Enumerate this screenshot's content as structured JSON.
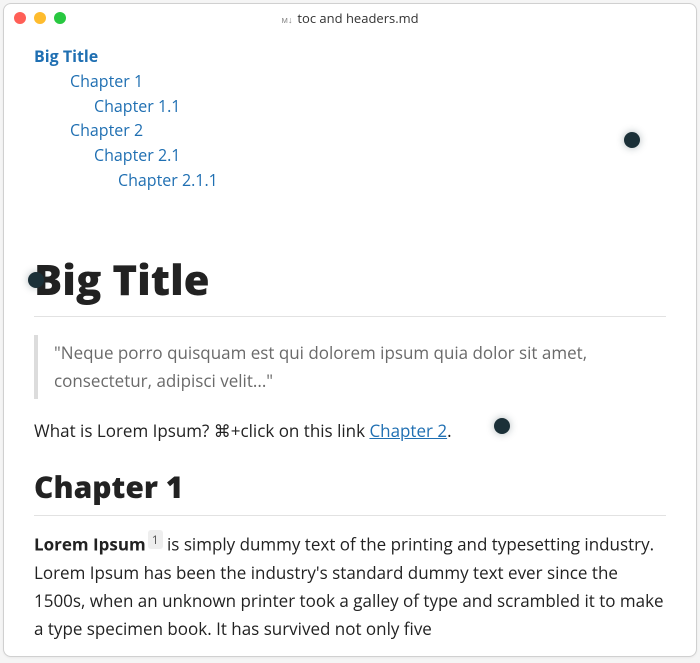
{
  "window": {
    "title": "toc and headers.md"
  },
  "toc": {
    "items": [
      {
        "label": "Big Title",
        "level": 1
      },
      {
        "label": "Chapter 1",
        "level": 2
      },
      {
        "label": "Chapter 1.1",
        "level": 3
      },
      {
        "label": "Chapter 2",
        "level": 2
      },
      {
        "label": "Chapter 2.1",
        "level": 3
      },
      {
        "label": "Chapter 2.1.1",
        "level": 4
      }
    ]
  },
  "doc": {
    "h1": "Big Title",
    "quote": "\"Neque porro quisquam est qui dolorem ipsum quia dolor sit amet, consectetur, adipisci velit...\"",
    "intro_before_link": "What is Lorem Ipsum? ⌘+click on this link ",
    "intro_link_text": "Chapter 2",
    "intro_after_link": ".",
    "h2": "Chapter 1",
    "para_lead": "Lorem Ipsum",
    "footnote_marker": "1",
    "para_rest": " is simply dummy text of the printing and typesetting industry. Lorem Ipsum has been the industry's standard dummy text ever since the 1500s, when an unknown printer took a galley of type and scrambled it to make a type specimen book. It has survived not only five"
  }
}
